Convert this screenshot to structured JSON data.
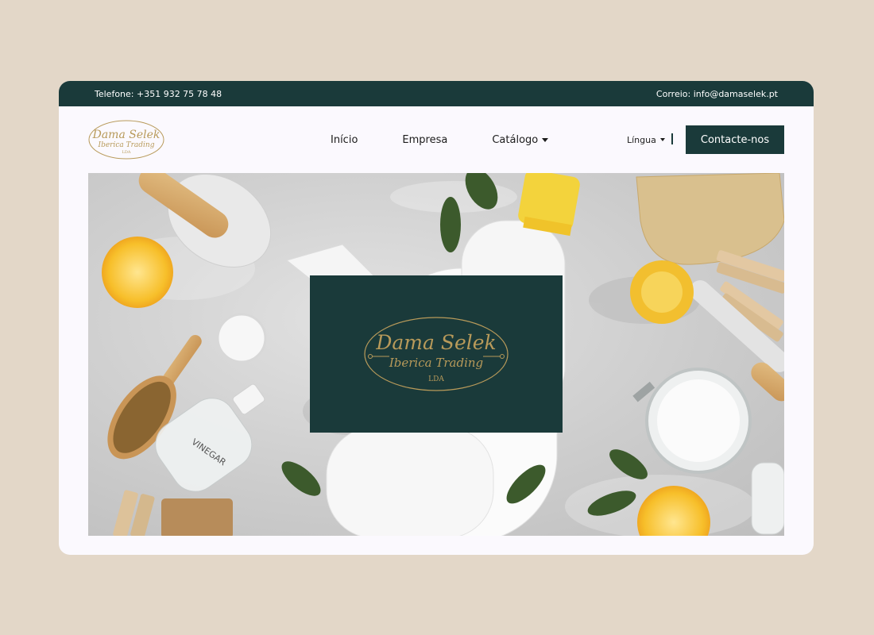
{
  "topbar": {
    "phone": "Telefone: +351 932 75 78 48",
    "email": "Correio: info@damaselek.pt"
  },
  "brand": {
    "name": "Dama Selek",
    "tagline": "Iberica Trading",
    "suffix": "LDA",
    "gold": "#b89a5a",
    "dark": "#1a3a3a"
  },
  "nav": {
    "items": [
      {
        "label": "Início"
      },
      {
        "label": "Empresa"
      },
      {
        "label": "Catálogo",
        "dropdown": true
      }
    ],
    "language": "Língua",
    "contact_button": "Contacte-nos"
  },
  "hero": {
    "jar_label": "VINEGAR"
  }
}
